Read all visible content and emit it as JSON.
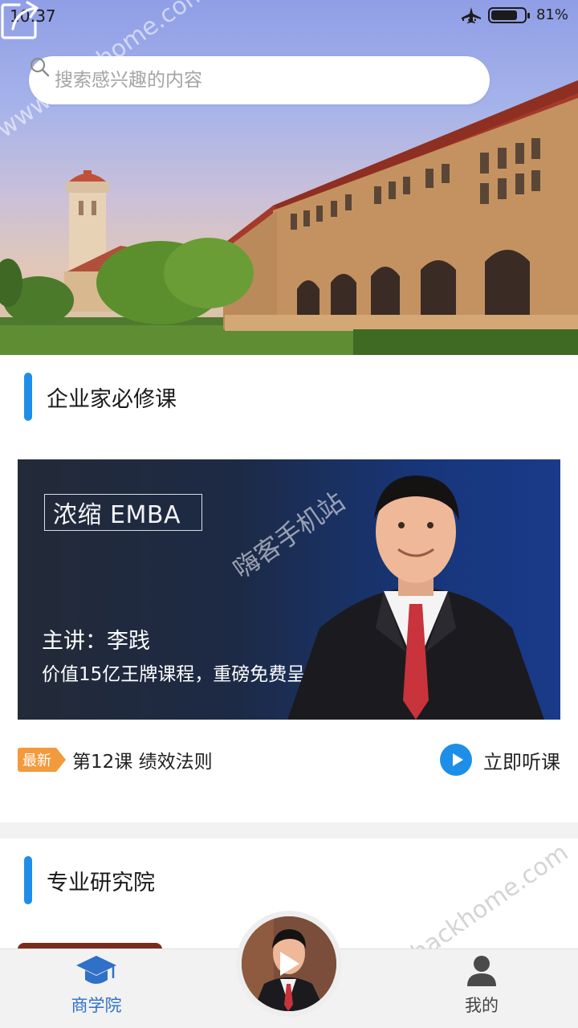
{
  "status_bar": {
    "time": "10:37",
    "signal_dots": "...",
    "battery_percent": "81%",
    "battery_level": 0.81
  },
  "search": {
    "placeholder": "搜索感兴趣的内容"
  },
  "section1": {
    "title": "企业家必修课",
    "banner": {
      "tag": "浓缩 EMBA",
      "speaker": "主讲：李践",
      "description": "价值15亿王牌课程，重磅免费呈现"
    },
    "lesson": {
      "badge": "最新",
      "title": "第12课 绩效法则",
      "action_label": "立即听课"
    }
  },
  "section2": {
    "title": "专业研究院"
  },
  "bottom_nav": {
    "home_label": "商学院",
    "me_label": "我的"
  },
  "watermarks": {
    "site1": "www.hackhome.com",
    "site2": "嗨客手机站",
    "site3": "www.hackhome.com"
  },
  "colors": {
    "accent": "#1e8fe8",
    "badge": "#f39a3d",
    "nav_active": "#2f70c8"
  },
  "icons": {
    "search": "search-icon",
    "share": "share-icon",
    "play": "play-icon",
    "home": "graduation-cap-icon",
    "me": "person-icon",
    "airplane": "airplane-mode-icon",
    "battery": "battery-icon"
  }
}
